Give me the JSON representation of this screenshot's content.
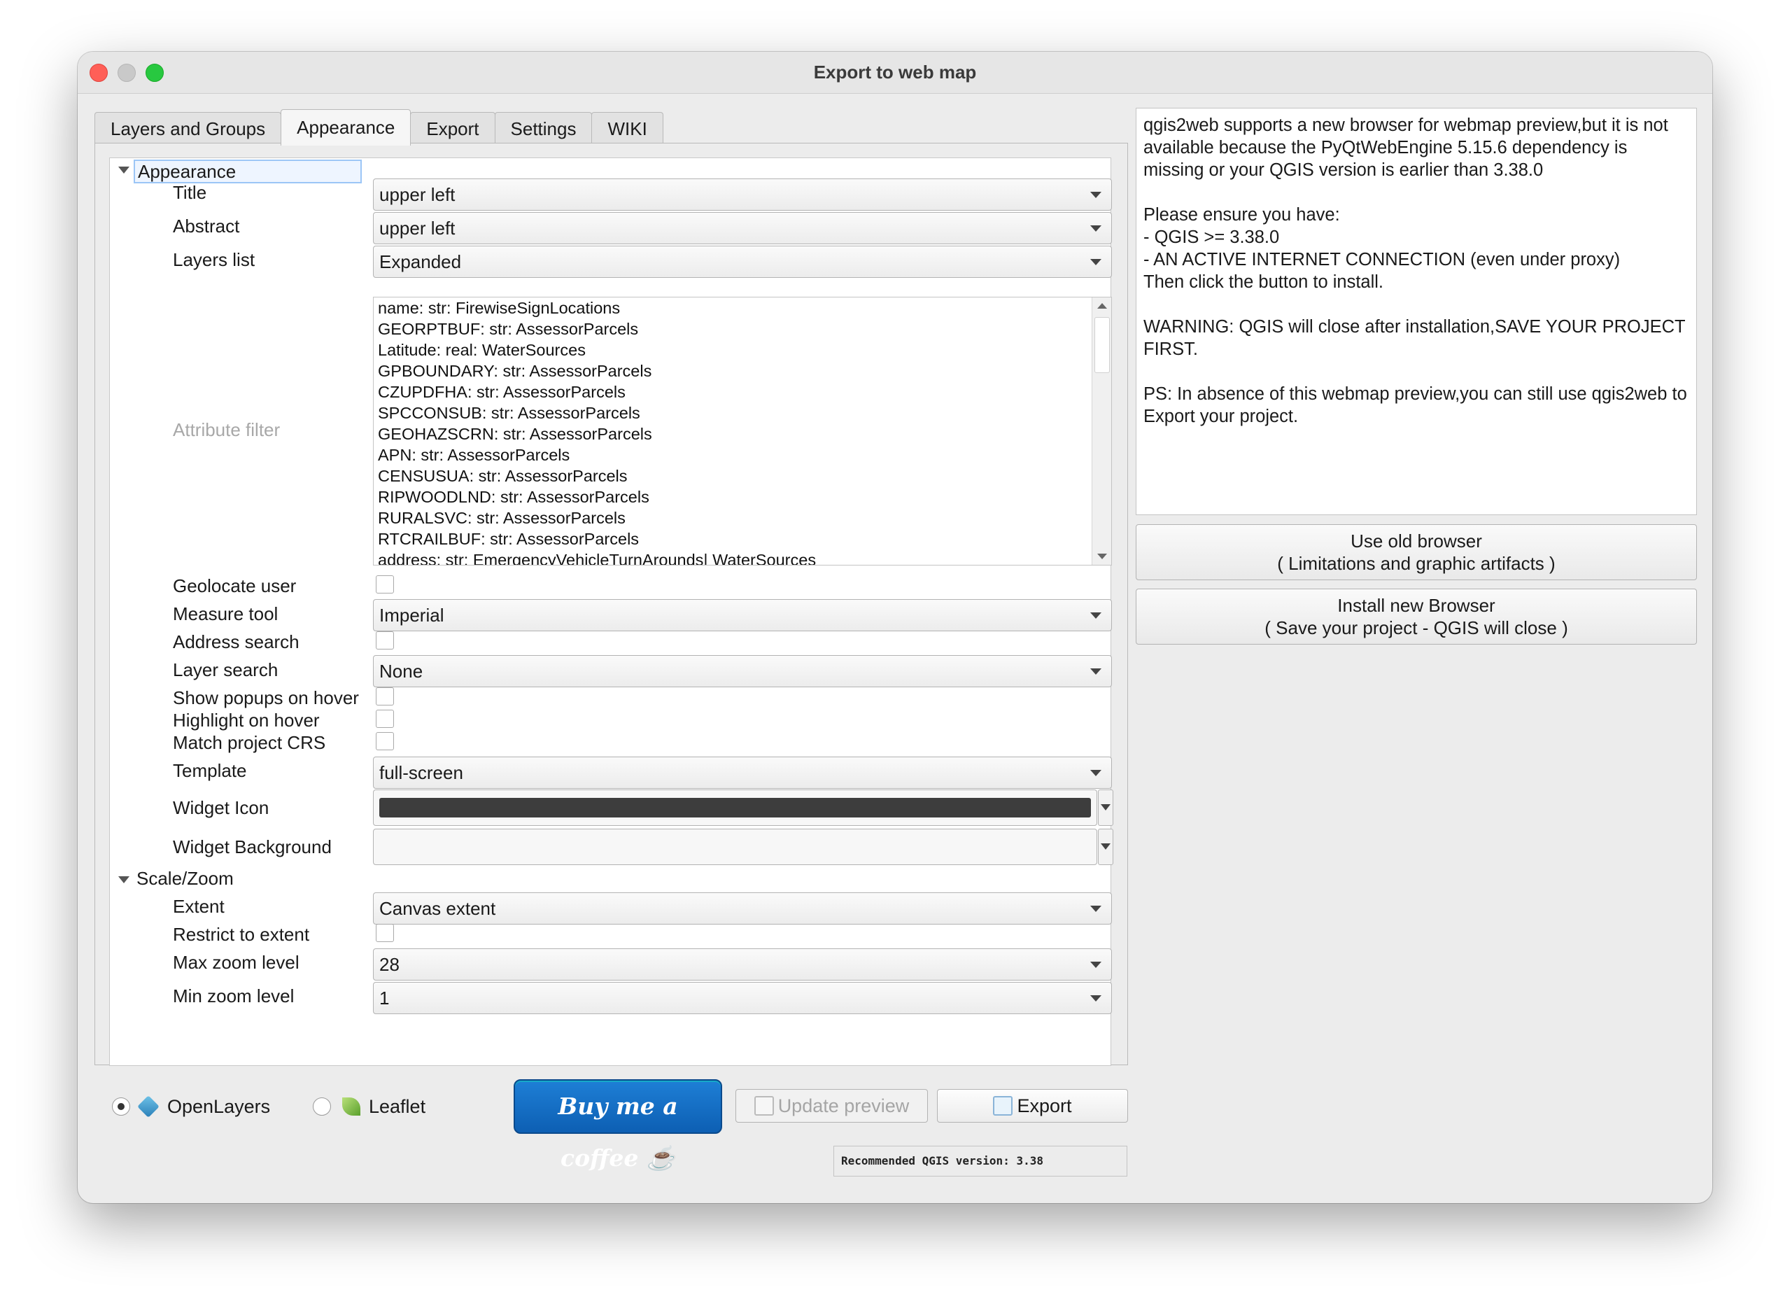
{
  "window": {
    "title": "Export to web map"
  },
  "tabs": [
    {
      "label": "Layers and Groups"
    },
    {
      "label": "Appearance"
    },
    {
      "label": "Export"
    },
    {
      "label": "Settings"
    },
    {
      "label": "WIKI"
    }
  ],
  "appearance": {
    "section_label": "Appearance",
    "title_label": "Title",
    "title_value": "upper left",
    "abstract_label": "Abstract",
    "abstract_value": "upper left",
    "layers_list_label": "Layers list",
    "layers_list_value": "Expanded",
    "attribute_filter_label": "Attribute filter",
    "attribute_filter_items": [
      "name: str: FirewiseSignLocations",
      "GEORPTBUF: str: AssessorParcels",
      "Latitude: real: WaterSources",
      "GPBOUNDARY: str: AssessorParcels",
      "CZUPDFHA: str: AssessorParcels",
      "SPCCONSUB: str: AssessorParcels",
      "GEOHAZSCRN: str: AssessorParcels",
      "APN: str: AssessorParcels",
      "CENSUSUA: str: AssessorParcels",
      "RIPWOODLND: str: AssessorParcels",
      "RURALSVC: str: AssessorParcels",
      "RTCRAILBUF: str: AssessorParcels",
      "address: str: EmergencyVehicleTurnArounds| WaterSources"
    ],
    "geolocate_label": "Geolocate user",
    "measure_label": "Measure tool",
    "measure_value": "Imperial",
    "address_search_label": "Address search",
    "layer_search_label": "Layer search",
    "layer_search_value": "None",
    "popups_hover_label": "Show popups on hover",
    "highlight_hover_label": "Highlight on hover",
    "match_crs_label": "Match project CRS",
    "template_label": "Template",
    "template_value": "full-screen",
    "widget_icon_label": "Widget Icon",
    "widget_icon_color": "#3d3d3d",
    "widget_bg_label": "Widget Background",
    "widget_bg_color": "#f7f7f7"
  },
  "scale_zoom": {
    "section_label": "Scale/Zoom",
    "extent_label": "Extent",
    "extent_value": "Canvas extent",
    "restrict_label": "Restrict to extent",
    "max_zoom_label": "Max zoom level",
    "max_zoom_value": "28",
    "min_zoom_label": "Min zoom level",
    "min_zoom_value": "1"
  },
  "bottom": {
    "openlayers_label": "OpenLayers",
    "leaflet_label": "Leaflet",
    "coffee_label": "Buy me a coffee ☕",
    "update_preview_label": "Update preview",
    "export_label": "Export",
    "version_text": "Recommended QGIS version: 3.38"
  },
  "info": {
    "text": "qgis2web supports a new browser for webmap preview,but it is not available because the PyQtWebEngine 5.15.6 dependency is missing or your QGIS version is earlier than 3.38.0\n\nPlease ensure you have:\n- QGIS >= 3.38.0\n- AN ACTIVE INTERNET CONNECTION (even under proxy)\nThen click the button to install.\n\nWARNING: QGIS will close after installation,SAVE YOUR PROJECT FIRST.\n\nPS: In absence of this webmap preview,you can still use qgis2web to Export your project."
  },
  "right_buttons": {
    "old_browser_line1": "Use old browser",
    "old_browser_line2": "( Limitations and graphic artifacts )",
    "install_line1": "Install new Browser",
    "install_line2": "( Save your project - QGIS will close )"
  }
}
